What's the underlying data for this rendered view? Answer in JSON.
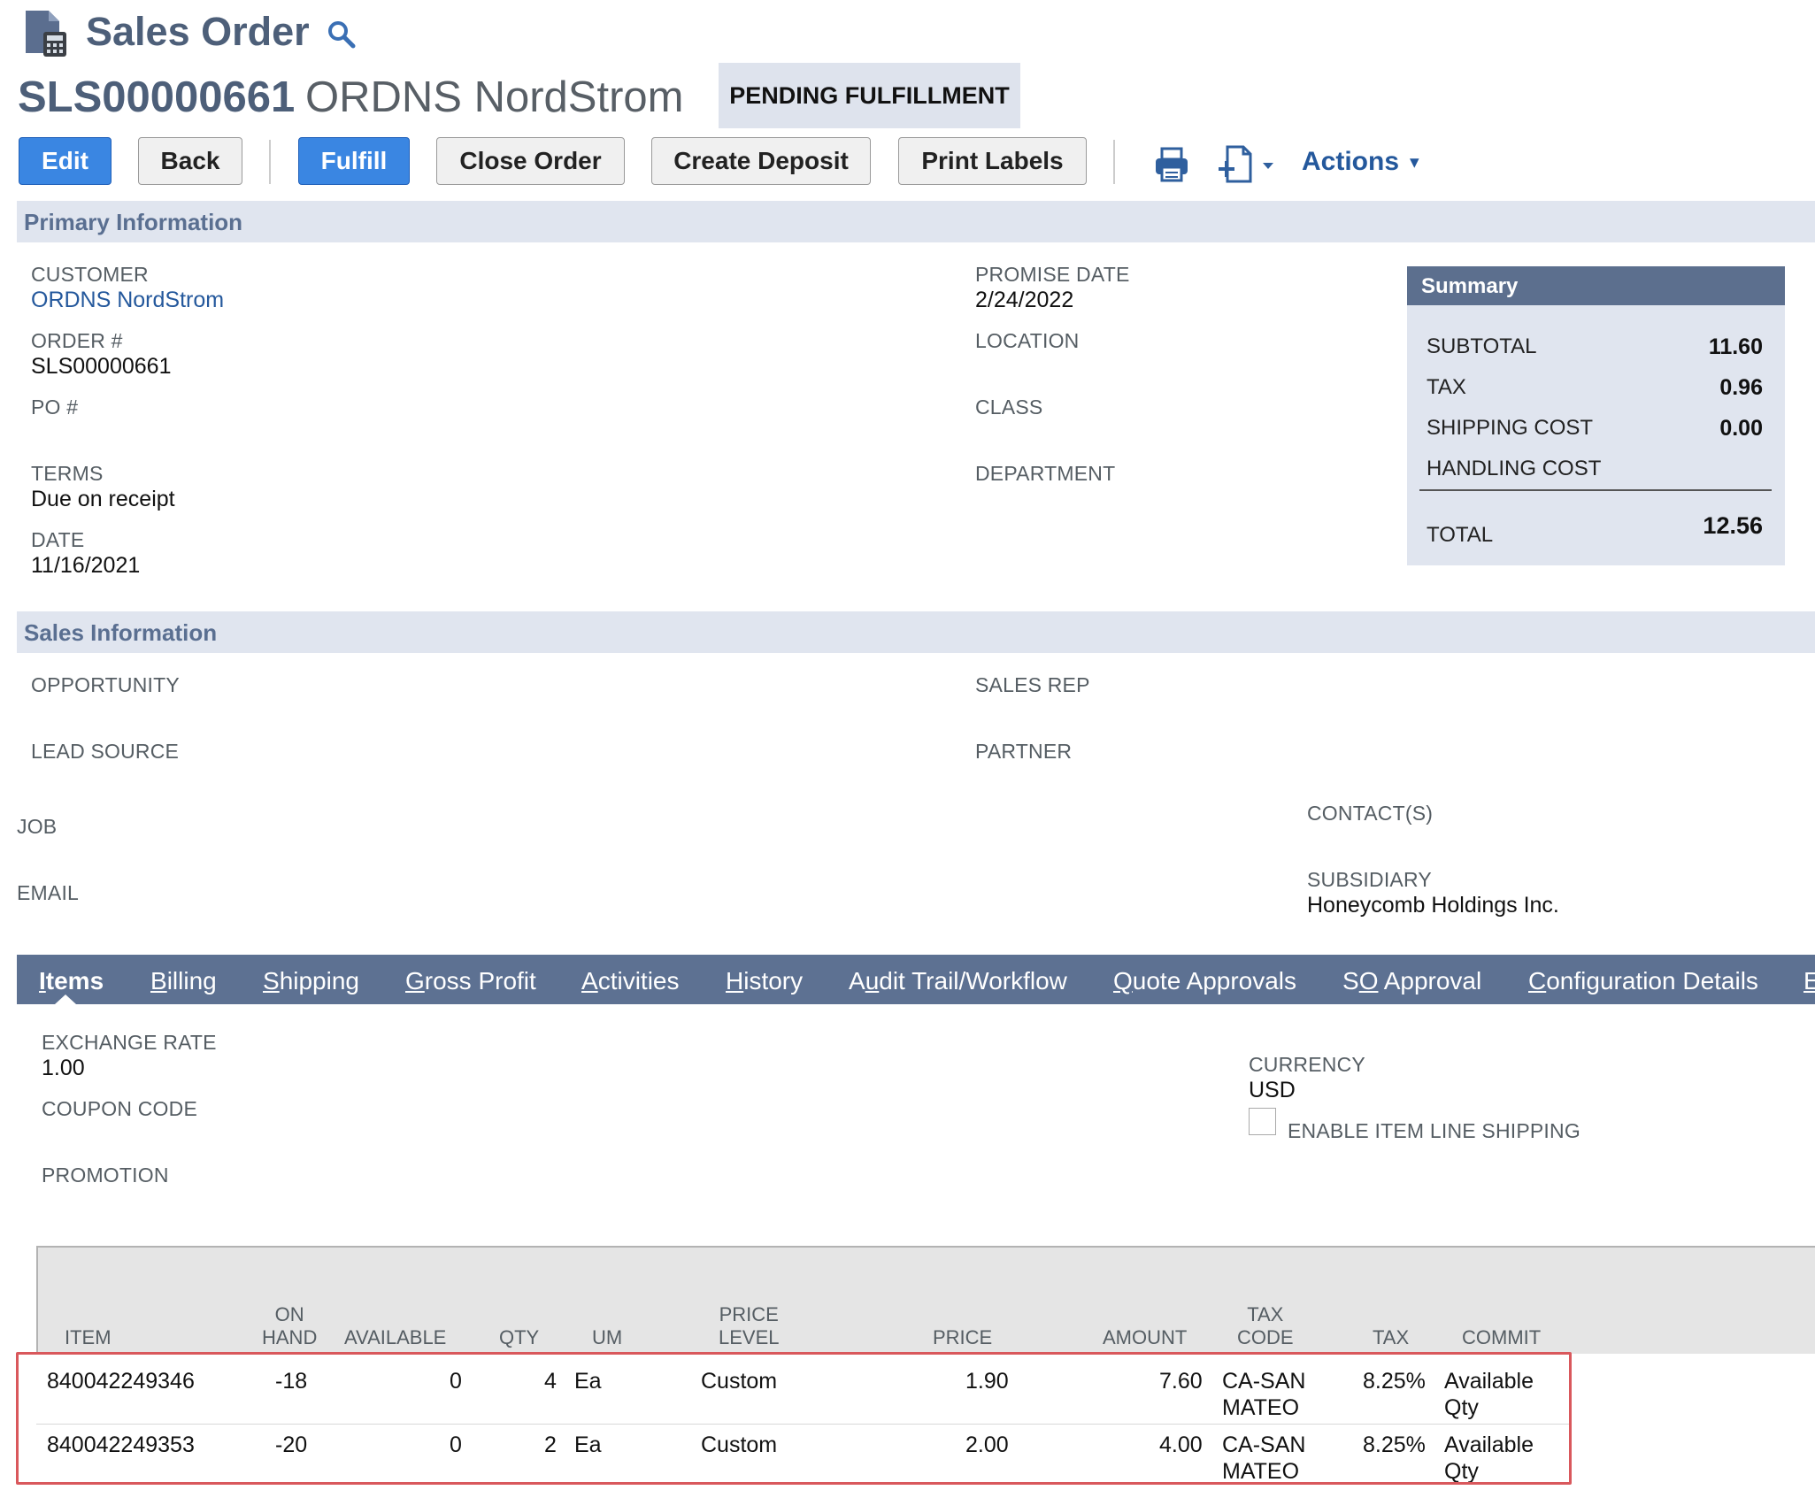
{
  "header": {
    "title": "Sales Order",
    "order_number": "SLS00000661",
    "customer_name": "ORDNS NordStrom",
    "status": "PENDING FULFILLMENT"
  },
  "toolbar": {
    "edit": "Edit",
    "back": "Back",
    "fulfill": "Fulfill",
    "close_order": "Close Order",
    "create_deposit": "Create Deposit",
    "print_labels": "Print Labels",
    "actions": "Actions"
  },
  "primary": {
    "section_title": "Primary Information",
    "customer": {
      "label": "CUSTOMER",
      "value": "ORDNS NordStrom"
    },
    "order_num": {
      "label": "ORDER #",
      "value": "SLS00000661"
    },
    "po": {
      "label": "PO #",
      "value": ""
    },
    "terms": {
      "label": "TERMS",
      "value": "Due on receipt"
    },
    "date": {
      "label": "DATE",
      "value": "11/16/2021"
    },
    "promise_date": {
      "label": "PROMISE DATE",
      "value": "2/24/2022"
    },
    "location": {
      "label": "LOCATION",
      "value": ""
    },
    "class": {
      "label": "CLASS",
      "value": ""
    },
    "department": {
      "label": "DEPARTMENT",
      "value": ""
    }
  },
  "summary": {
    "title": "Summary",
    "subtotal": {
      "label": "SUBTOTAL",
      "value": "11.60"
    },
    "tax": {
      "label": "TAX",
      "value": "0.96"
    },
    "shipping_cost": {
      "label": "SHIPPING COST",
      "value": "0.00"
    },
    "handling_cost": {
      "label": "HANDLING COST",
      "value": ""
    },
    "total": {
      "label": "TOTAL",
      "value": "12.56"
    }
  },
  "sales": {
    "section_title": "Sales Information",
    "opportunity": "OPPORTUNITY",
    "lead_source": "LEAD SOURCE",
    "job": "JOB",
    "email": "EMAIL",
    "sales_rep": "SALES REP",
    "partner": "PARTNER",
    "contacts": "CONTACT(S)",
    "subsidiary": {
      "label": "SUBSIDIARY",
      "value": "Honeycomb Holdings Inc."
    }
  },
  "tabs": [
    {
      "key": "I",
      "rest": "tems"
    },
    {
      "key": "B",
      "rest": "illing"
    },
    {
      "key": "S",
      "rest": "hipping"
    },
    {
      "key": "G",
      "rest": "ross Profit"
    },
    {
      "key": "A",
      "rest": "ctivities"
    },
    {
      "key": "H",
      "rest": "istory"
    },
    {
      "pre": "A",
      "key": "u",
      "rest": "dit Trail/Workflow"
    },
    {
      "key": "Q",
      "rest": "uote Approvals"
    },
    {
      "pre": "S",
      "key": "O",
      "rest": " Approval"
    },
    {
      "key": "C",
      "rest": "onfiguration Details"
    },
    {
      "key": "E",
      "rest": ""
    }
  ],
  "items_tab": {
    "exchange_rate": {
      "label": "EXCHANGE RATE",
      "value": "1.00"
    },
    "coupon_code": "COUPON CODE",
    "promotion": "PROMOTION",
    "currency": {
      "label": "CURRENCY",
      "value": "USD"
    },
    "line_shipping": "ENABLE ITEM LINE SHIPPING"
  },
  "table": {
    "headers": {
      "item": "ITEM",
      "on_hand_1": "ON",
      "on_hand_2": "HAND",
      "available": "AVAILABLE",
      "qty": "QTY",
      "um": "UM",
      "price_level_1": "PRICE",
      "price_level_2": "LEVEL",
      "price": "PRICE",
      "amount": "AMOUNT",
      "tax_code_1": "TAX",
      "tax_code_2": "CODE",
      "tax": "TAX",
      "commit": "COMMIT"
    },
    "rows": [
      {
        "item": "840042249346",
        "on_hand": "-18",
        "available": "0",
        "qty": "4",
        "um": "Ea",
        "price_level": "Custom",
        "price": "1.90",
        "amount": "7.60",
        "tax_code_1": "CA-SAN",
        "tax_code_2": "MATEO",
        "tax": "8.25%",
        "commit_1": "Available",
        "commit_2": "Qty"
      },
      {
        "item": "840042249353",
        "on_hand": "-20",
        "available": "0",
        "qty": "2",
        "um": "Ea",
        "price_level": "Custom",
        "price": "2.00",
        "amount": "4.00",
        "tax_code_1": "CA-SAN",
        "tax_code_2": "MATEO",
        "tax": "8.25%",
        "commit_1": "Available",
        "commit_2": "Qty"
      }
    ]
  },
  "colors": {
    "accent_blue": "#3a86e2",
    "header_text": "#4d5f79",
    "tab_bar": "#5d7192",
    "section_bg": "#e0e5ef",
    "highlight": "#d9585c"
  }
}
